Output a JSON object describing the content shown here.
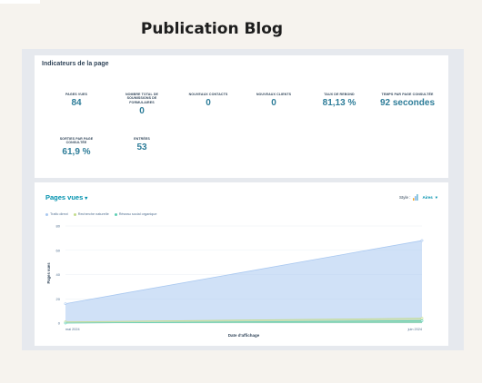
{
  "page": {
    "title": "Publication Blog"
  },
  "kpi_card": {
    "title": "Indicateurs de la page",
    "metrics": [
      {
        "label": "PAGES VUES",
        "value": "84"
      },
      {
        "label": "NOMBRE TOTAL DE SOUMISSIONS DE FORMULAIRES",
        "value": "0"
      },
      {
        "label": "NOUVEAUX CONTACTS",
        "value": "0"
      },
      {
        "label": "NOUVEAUX CLIENTS",
        "value": "0"
      },
      {
        "label": "TAUX DE REBOND",
        "value": "81,13 %"
      },
      {
        "label": "TEMPS PAR PAGE CONSULTÉE",
        "value": "92 secondes"
      },
      {
        "label": "SORTIES PAR PAGE CONSULTÉE",
        "value": "61,9 %"
      },
      {
        "label": "ENTRÉES",
        "value": "53"
      }
    ]
  },
  "chart_card": {
    "title": "Pages vues",
    "style_label": "Style :",
    "style_value": "Aires",
    "style_icon": "area-chart-icon"
  },
  "colors": {
    "accent": "#0091ae",
    "kpi_value": "#2e7d99",
    "series_direct": "#a9c8f0",
    "series_organic": "#c3dc8c",
    "series_social": "#5fcfb5"
  },
  "chart_data": {
    "type": "area",
    "title": "Pages vues",
    "xlabel": "Date d'affichage",
    "ylabel": "Pages vues",
    "x": [
      "mai 2024",
      "juin 2024"
    ],
    "ylim": [
      0,
      80
    ],
    "yticks": [
      0,
      20,
      40,
      60,
      80
    ],
    "grid": true,
    "legend_position": "top-left",
    "series": [
      {
        "name": "Trafic direct",
        "values": [
          16,
          68
        ],
        "color": "#a9c8f0"
      },
      {
        "name": "Recherche naturelle",
        "values": [
          1,
          4
        ],
        "color": "#c3dc8c"
      },
      {
        "name": "Réseau social organique",
        "values": [
          0,
          2
        ],
        "color": "#5fcfb5"
      }
    ]
  }
}
